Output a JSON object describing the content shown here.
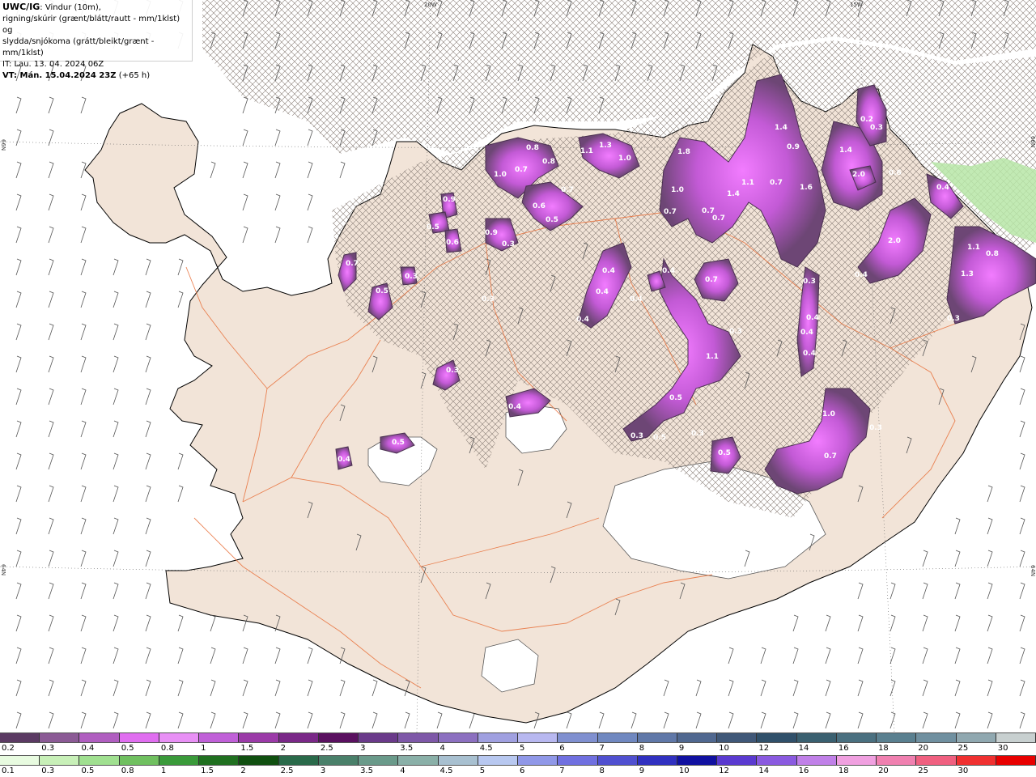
{
  "info": {
    "line1_bold": "UWC/IG",
    "line1_rest": ": Vindur (10m),",
    "line2": "rigning/skúrir (grænt/blátt/rautt - mm/1klst) og",
    "line3": "slydda/snjókoma (grátt/bleikt/grænt - mm/1klst)",
    "line4": "IT: Lau. 13. 04. 2024 06Z",
    "line5_bold": "VT: Mán. 15.04.2024 23Z",
    "line5_rest": " (+65 h)"
  },
  "grid_labels": {
    "lon_20w": "20W",
    "lon_15w": "15W",
    "lat_66n_left": "66N",
    "lat_66n_right": "66N",
    "lat_64n_left": "64N",
    "lat_64n_right": "64N"
  },
  "precip_labels": [
    {
      "text": "1.4"
    },
    {
      "text": "0.3"
    },
    {
      "text": "0.2"
    },
    {
      "text": "1.4"
    },
    {
      "text": "2.0"
    },
    {
      "text": "0.6"
    },
    {
      "text": "1.8"
    },
    {
      "text": "1.0"
    },
    {
      "text": "1.1"
    },
    {
      "text": "0.7"
    },
    {
      "text": "1.4"
    },
    {
      "text": "1.6"
    },
    {
      "text": "0.9"
    },
    {
      "text": "0.7"
    },
    {
      "text": "0.7"
    },
    {
      "text": "0.7"
    },
    {
      "text": "1.0"
    },
    {
      "text": "0.8"
    },
    {
      "text": "0.7"
    },
    {
      "text": "0.8"
    },
    {
      "text": "1.1"
    },
    {
      "text": "1.3"
    },
    {
      "text": "1.0"
    },
    {
      "text": "0.9"
    },
    {
      "text": "0.5"
    },
    {
      "text": "0.6"
    },
    {
      "text": "0.6"
    },
    {
      "text": "0.5"
    },
    {
      "text": "0.7"
    },
    {
      "text": "0.9"
    },
    {
      "text": "0.3"
    },
    {
      "text": "0.4"
    },
    {
      "text": "2.0"
    },
    {
      "text": "0.4"
    },
    {
      "text": "1.1"
    },
    {
      "text": "0.8"
    },
    {
      "text": "1.3"
    },
    {
      "text": "0.3"
    },
    {
      "text": "0.4"
    },
    {
      "text": "0.4"
    },
    {
      "text": "0.4"
    },
    {
      "text": "0.4"
    },
    {
      "text": "0.4"
    },
    {
      "text": "0.3"
    },
    {
      "text": "0.4"
    },
    {
      "text": "0.4"
    },
    {
      "text": "0.4"
    },
    {
      "text": "0.7"
    },
    {
      "text": "0.3"
    },
    {
      "text": "1.1"
    },
    {
      "text": "0.5"
    },
    {
      "text": "0.5"
    },
    {
      "text": "0.3"
    },
    {
      "text": "0.3"
    },
    {
      "text": "0.5"
    },
    {
      "text": "1.0"
    },
    {
      "text": "0.3"
    },
    {
      "text": "0.7"
    },
    {
      "text": "0.4"
    },
    {
      "text": "0.5"
    },
    {
      "text": "0.4"
    },
    {
      "text": "0.3"
    },
    {
      "text": "0.3"
    },
    {
      "text": "0.7"
    },
    {
      "text": "0.5"
    },
    {
      "text": "0.3"
    }
  ],
  "legend_snow": {
    "labels": [
      "0.2",
      "0.3",
      "0.4",
      "0.5",
      "0.8",
      "1",
      "1.5",
      "2",
      "2.5",
      "3",
      "3.5",
      "4",
      "4.5",
      "5",
      "6",
      "7",
      "8",
      "9",
      "10",
      "12",
      "14",
      "16",
      "18",
      "20",
      "25",
      "30"
    ],
    "colors": [
      "#5b3a63",
      "#8b5a95",
      "#b05ec0",
      "#e06ef0",
      "#e890f5",
      "#c060d8",
      "#9b3aa8",
      "#7a2888",
      "#5a1060",
      "#6a3a8a",
      "#7e58a8",
      "#8c70c0",
      "#a0a0e0",
      "#b8b8f0",
      "#8090d0",
      "#7088c0",
      "#6078a8",
      "#506890",
      "#405878",
      "#30506a",
      "#3a6070",
      "#4a7080",
      "#5a8090",
      "#7090a0",
      "#90a8b0",
      "#c8d0d0"
    ]
  },
  "legend_rain": {
    "labels": [
      "0.1",
      "0.3",
      "0.5",
      "0.8",
      "1",
      "1.5",
      "2",
      "2.5",
      "3",
      "3.5",
      "4",
      "4.5",
      "5",
      "6",
      "7",
      "8",
      "9",
      "10",
      "12",
      "14",
      "16",
      "18",
      "20",
      "25",
      "30"
    ],
    "colors": [
      "#e8fbe0",
      "#c8f0b8",
      "#a0e090",
      "#70c060",
      "#3a9a3a",
      "#207020",
      "#105010",
      "#2a6a4a",
      "#4a806a",
      "#6a9a8a",
      "#8ab0a8",
      "#a8c0d0",
      "#b8c8f0",
      "#9098e8",
      "#7070e0",
      "#5050d0",
      "#3030c0",
      "#1010a0",
      "#5a3ad0",
      "#8a5ae0",
      "#c080e8",
      "#f0a0e0",
      "#f080b0",
      "#f06080",
      "#f03030",
      "#e80000"
    ]
  }
}
